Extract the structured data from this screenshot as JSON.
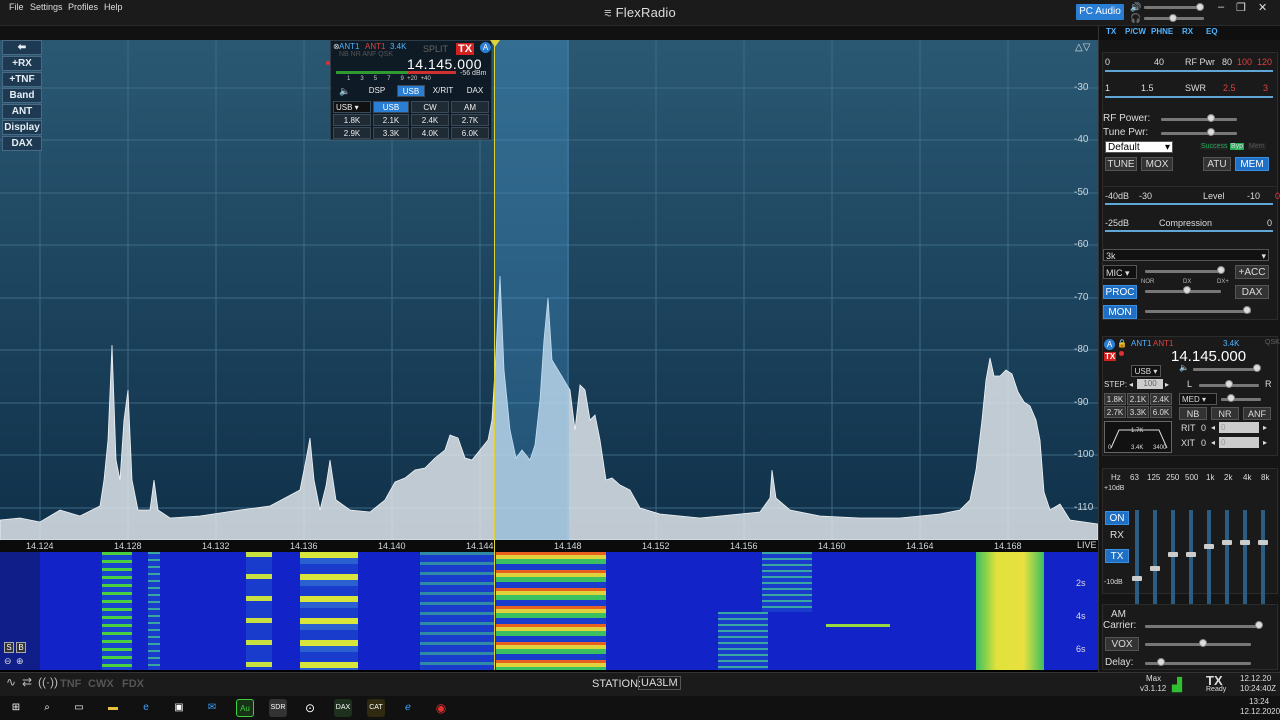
{
  "menu": {
    "file": "File",
    "settings": "Settings",
    "profiles": "Profiles",
    "help": "Help"
  },
  "brand": "FlexRadio",
  "pc_audio": "PC Audio",
  "window_controls": {
    "minimize": "–",
    "restore": "❐",
    "close": "✕"
  },
  "left_buttons": [
    "⬅",
    "+RX",
    "+TNF",
    "Band",
    "ANT",
    "Display",
    "DAX"
  ],
  "pan": {
    "db_labels": [
      "-30",
      "-40",
      "-50",
      "-60",
      "-70",
      "-80",
      "-90",
      "-100",
      "-110"
    ],
    "freq_labels": [
      "14.124",
      "14.128",
      "14.132",
      "14.136",
      "14.140",
      "14.144",
      "14.148",
      "14.152",
      "14.156",
      "14.160",
      "14.164",
      "14.168"
    ],
    "live": "LIVE",
    "waterfall_times": [
      "2s",
      "4s",
      "6s"
    ]
  },
  "slice": {
    "ant_rx": "ANT1",
    "ant_tx": "ANT1",
    "filter": "3.4K",
    "split": "SPLIT",
    "tx": "TX",
    "letter": "A",
    "dsp_flags": "NB NR ANF QSK",
    "freq": "14.145.000",
    "signal": "-56 dBm",
    "smeter_scale": [
      "1",
      "3",
      "5",
      "7",
      "9",
      "+20",
      "+40"
    ],
    "tabs": [
      "DSP",
      "USB",
      "X/RIT",
      "DAX"
    ],
    "mode_select": "USB",
    "modes": [
      "USB",
      "CW",
      "AM"
    ],
    "filters": [
      "1.8K",
      "2.1K",
      "2.4K",
      "2.7K",
      "2.9K",
      "3.3K",
      "4.0K",
      "6.0K"
    ]
  },
  "right": {
    "tabs": [
      "TX",
      "P/CW",
      "PHNE",
      "RX",
      "EQ"
    ],
    "rfpwr_scale": [
      "0",
      "40",
      "RF Pwr",
      "80",
      "100",
      "120"
    ],
    "swr_scale": [
      "1",
      "1.5",
      "SWR",
      "2.5",
      "3"
    ],
    "rf_power": "RF Power:",
    "tune_pwr": "Tune Pwr:",
    "profile": "Default",
    "success": "Success",
    "byp": "Byp",
    "mem": "Mem",
    "tune": "TUNE",
    "mox": "MOX",
    "atu": "ATU",
    "mem_btn": "MEM",
    "level_scale": [
      "-40dB",
      "-30",
      "Level",
      "-10",
      "0"
    ],
    "comp_scale": [
      "-25dB",
      "Compression",
      "0"
    ],
    "tx_filter": "3k",
    "mic": "MIC",
    "acc": "+ACC",
    "nor": "NOR",
    "dx": "DX",
    "dxp": "DX+",
    "proc": "PROC",
    "dax": "DAX",
    "mon": "MON",
    "slice2": {
      "ant_rx": "ANT1",
      "ant_tx": "ANT1",
      "filter": "3.4K",
      "qsk": "QSK",
      "freq": "14.145.000",
      "mode": "USB",
      "step_label": "STEP:",
      "step": "100",
      "filters": [
        "1.8K",
        "2.1K",
        "2.4K",
        "2.7K",
        "3.3K",
        "6.0K"
      ],
      "agc": "MED",
      "l": "L",
      "r": "R",
      "nb": "NB",
      "nr": "NR",
      "anf": "ANF",
      "rit": "RIT",
      "xit": "XIT",
      "rit_val": "0",
      "xit_val": "0",
      "rit_field": "0",
      "xit_field": "0",
      "filter_graph": [
        "1.7K",
        "0",
        "3.4K",
        "3400"
      ]
    },
    "eq_freqs": [
      "Hz",
      "63",
      "125",
      "250",
      "500",
      "1k",
      "2k",
      "4k",
      "8k"
    ],
    "eq_top": "+10dB",
    "eq_bottom": "-10dB",
    "eq_on": "ON",
    "eq_rx": "RX",
    "eq_tx": "TX",
    "am_label": "AM",
    "carrier": "Carrier:",
    "vox": "VOX",
    "delay": "Delay:"
  },
  "status": {
    "modes": [
      "TNF",
      "CWX",
      "FDX"
    ],
    "station_label": "STATION:",
    "station": "UA3LM",
    "max": "Max",
    "version": "v3.1.12",
    "tx": "TX",
    "ready": "Ready",
    "date": "12.12.20",
    "time": "10:24:40Z"
  },
  "taskbar": {
    "time": "13:24",
    "date": "12.12.2020"
  },
  "sb": {
    "s": "S",
    "b": "B"
  }
}
